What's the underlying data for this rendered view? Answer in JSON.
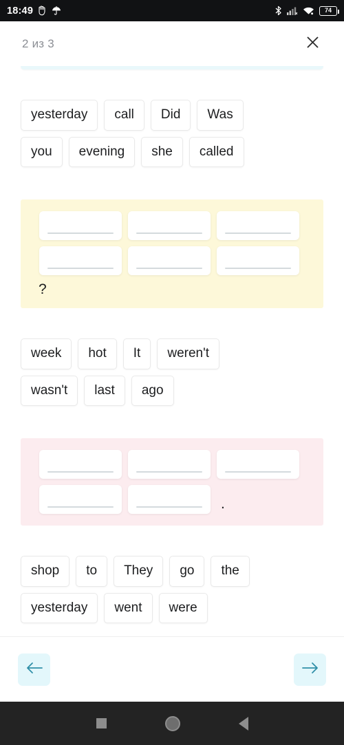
{
  "statusbar": {
    "time": "18:49",
    "left_icons": [
      "do-not-disturb-icon",
      "umbrella-icon"
    ],
    "right_icons": [
      "bluetooth-icon",
      "cellular-signal-icon",
      "wifi-icon"
    ],
    "battery_level": "74"
  },
  "header": {
    "title": "2 из 3",
    "close_label": "close-icon"
  },
  "exercises": [
    {
      "bank": [
        [
          "yesterday",
          "call",
          "Did",
          "Was"
        ],
        [
          "you",
          "evening",
          "she",
          "called"
        ]
      ],
      "card_color": "#fdf8d9",
      "slot_rows": [
        [
          110,
          110,
          110
        ],
        [
          110,
          110,
          110
        ]
      ],
      "trailing_punctuation": "?"
    },
    {
      "bank": [
        [
          "week",
          "hot",
          "It",
          "weren't"
        ],
        [
          "wasn't",
          "last",
          "ago"
        ]
      ],
      "card_color": "#fcecef",
      "slot_rows": [
        [
          110,
          110,
          110
        ],
        [
          110,
          110
        ]
      ],
      "trailing_punctuation": "."
    },
    {
      "bank": [
        [
          "shop",
          "to",
          "They",
          "go",
          "the"
        ],
        [
          "yesterday",
          "went",
          "were"
        ]
      ],
      "card_color": "",
      "slot_rows": [],
      "trailing_punctuation": ""
    }
  ],
  "footer": {
    "prev_label": "arrow-left-icon",
    "next_label": "arrow-right-icon",
    "accent": "#2f8fa8",
    "button_bg": "#e3f7fb"
  },
  "android_nav": {
    "recents": "square-icon",
    "home": "circle-icon",
    "back": "triangle-back-icon"
  }
}
